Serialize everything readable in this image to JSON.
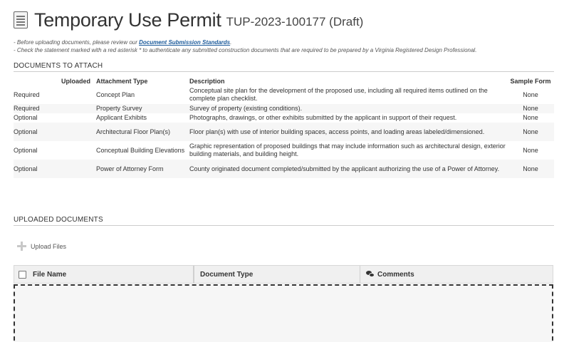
{
  "header": {
    "title": "Temporary Use Permit",
    "record_id": "TUP-2023-100177 (Draft)"
  },
  "notes": {
    "line1_prefix": "- Before uploading documents, please review our ",
    "line1_link": "Document Submission Standards",
    "line1_suffix": ".",
    "line2": "- Check the statement marked with a red asterisk * to authenticate any submitted construction documents that are required to be prepared by a Virginia Registered Design Professional."
  },
  "documents_to_attach": {
    "heading": "DOCUMENTS TO ATTACH",
    "columns": {
      "requirement": "",
      "uploaded": "Uploaded",
      "type": "Attachment Type",
      "description": "Description",
      "sample": "Sample Form"
    },
    "rows": [
      {
        "requirement": "Required",
        "uploaded": "",
        "type": "Concept Plan",
        "description": "Conceptual site plan for the development of the proposed use, including all required items outlined on the complete plan checklist.",
        "sample": "None"
      },
      {
        "requirement": "Required",
        "uploaded": "",
        "type": "Property Survey",
        "description": "Survey of property (existing conditions).",
        "sample": "None"
      },
      {
        "requirement": "Optional",
        "uploaded": "",
        "type": "Applicant Exhibits",
        "description": "Photographs, drawings, or other exhibits submitted by the applicant in support of their request.",
        "sample": "None"
      },
      {
        "requirement": "Optional",
        "uploaded": "",
        "type": "Architectural Floor Plan(s)",
        "description": "Floor plan(s) with use of interior building spaces, access points, and loading areas labeled/dimensioned.",
        "sample": "None"
      },
      {
        "requirement": "Optional",
        "uploaded": "",
        "type": "Conceptual Building Elevations",
        "description": "Graphic representation of proposed buildings that may include information such as architectural design, exterior building materials, and building height.",
        "sample": "None"
      },
      {
        "requirement": "Optional",
        "uploaded": "",
        "type": "Power of Attorney Form",
        "description": "County originated document completed/submitted by the applicant authorizing the use of a Power of Attorney.",
        "sample": "None"
      }
    ]
  },
  "uploaded_documents": {
    "heading": "UPLOADED DOCUMENTS",
    "upload_label": "Upload Files",
    "columns": {
      "file_name": "File Name",
      "document_type": "Document Type",
      "comments": "Comments"
    }
  },
  "icons": {
    "title_icon": "document-icon",
    "upload_icon": "plus-icon",
    "comments_icon": "chat-bubbles-icon"
  }
}
